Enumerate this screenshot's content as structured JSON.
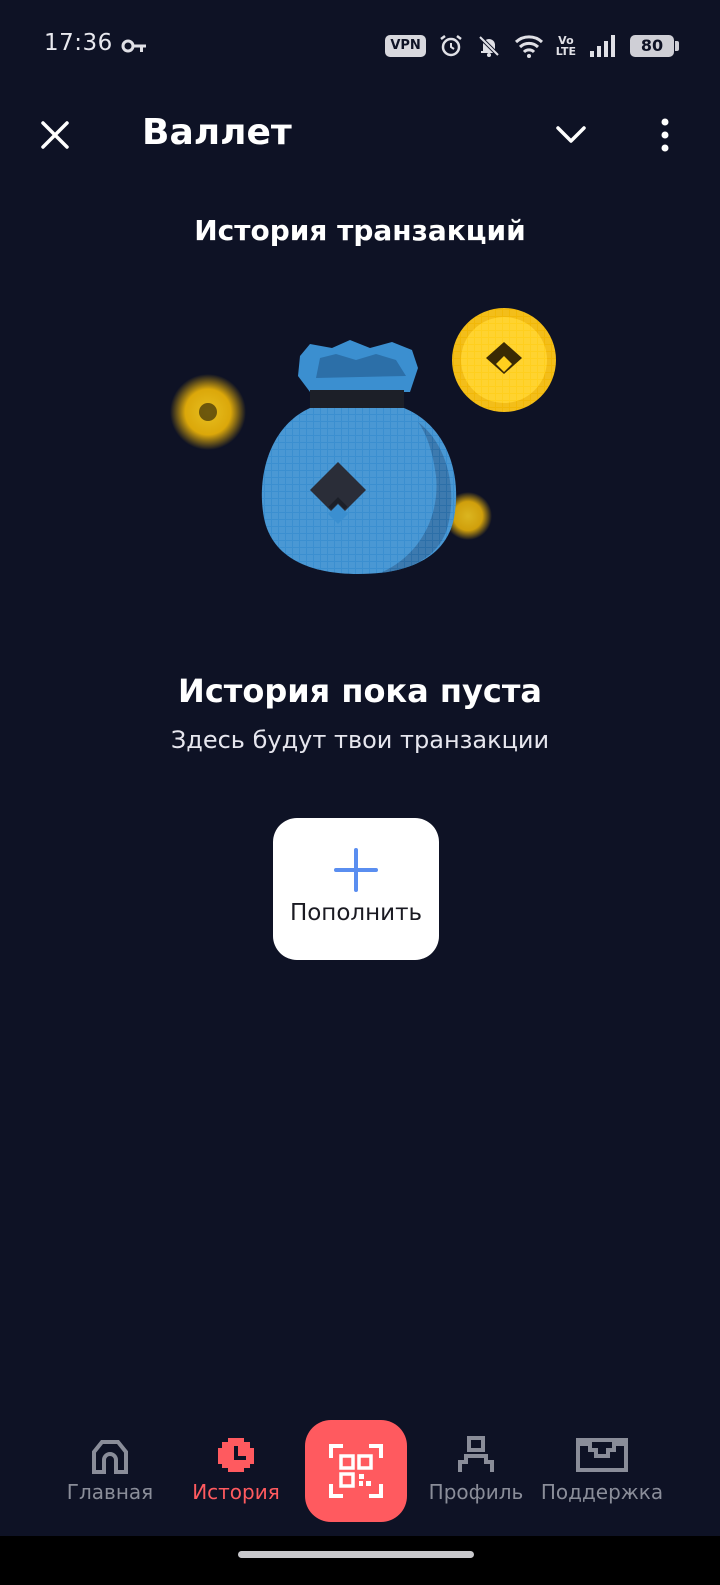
{
  "status_bar": {
    "time": "17:36",
    "vpn": "VPN",
    "volte_top": "Vo",
    "volte_bottom": "LTE",
    "battery": "80",
    "icons": [
      "key-icon",
      "alarm-icon",
      "bell-off-icon",
      "wifi-icon",
      "signal-icon",
      "battery-icon"
    ]
  },
  "header": {
    "title": "Валлет",
    "icons": [
      "close-icon",
      "chevron-down-icon",
      "more-vertical-icon"
    ]
  },
  "section_title": "История транзакций",
  "illustration": {
    "name": "money-bag-illustration",
    "colors": {
      "bag": "#3b8fd0",
      "coin": "#f2b807"
    }
  },
  "empty_state": {
    "title": "История пока пуста",
    "subtitle": "Здесь будут твои транзакции"
  },
  "topup_button": {
    "label": "Пополнить",
    "icon": "plus-icon",
    "icon_color": "#5a8ef0"
  },
  "bottom_nav": {
    "items": [
      {
        "label": "Главная",
        "icon": "home-icon",
        "active": false
      },
      {
        "label": "История",
        "icon": "clock-icon",
        "active": true
      },
      {
        "label": "Профиль",
        "icon": "user-icon",
        "active": false
      },
      {
        "label": "Поддержка",
        "icon": "mail-icon",
        "active": false
      }
    ],
    "scan": {
      "icon": "qr-scan-icon"
    },
    "colors": {
      "active": "#ff5a5f",
      "inactive": "#8a8d99"
    }
  },
  "theme": {
    "background": "#0e1225",
    "accent": "#ff5a5f"
  }
}
